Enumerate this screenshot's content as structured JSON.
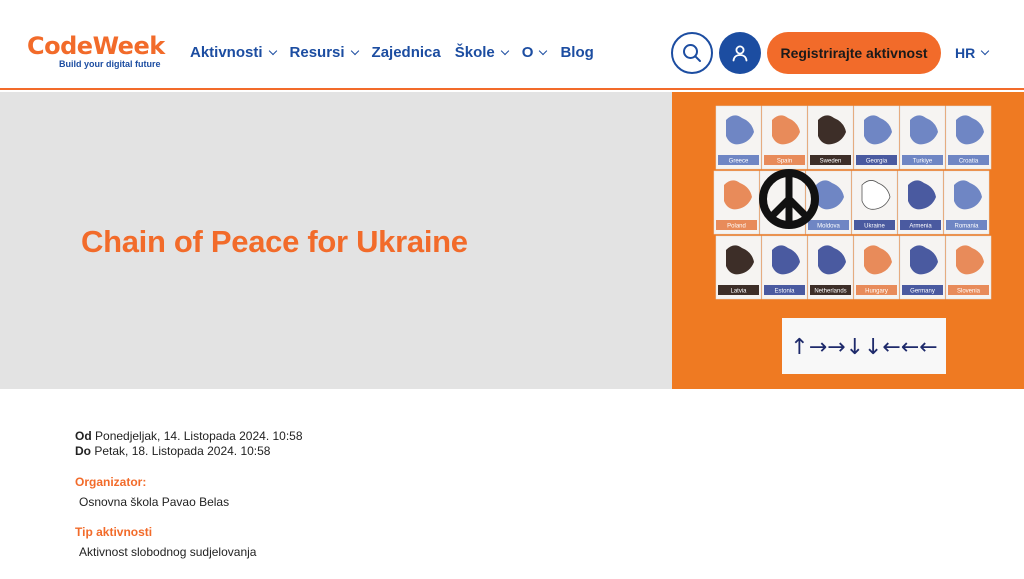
{
  "brand": {
    "code": "Code",
    "week": "Week",
    "tagline": "Build your digital future"
  },
  "nav": {
    "items": [
      {
        "label": "Aktivnosti",
        "dropdown": true
      },
      {
        "label": "Resursi",
        "dropdown": true
      },
      {
        "label": "Zajednica",
        "dropdown": false
      },
      {
        "label": "Škole",
        "dropdown": true
      },
      {
        "label": "O",
        "dropdown": true
      },
      {
        "label": "Blog",
        "dropdown": false
      }
    ]
  },
  "header": {
    "register_label": "Registrirajte aktivnost",
    "language": "HR"
  },
  "hero": {
    "title": "Chain of Peace for Ukraine",
    "image": {
      "cards_row1": [
        "Greece",
        "Spain",
        "Sweden",
        "Georgia",
        "Turkiye",
        "Croatia"
      ],
      "cards_row2": [
        "Poland",
        "",
        "Moldova",
        "Ukraine",
        "Armenia",
        "Romania"
      ],
      "cards_row3": [
        "Latvia",
        "Estonia",
        "Netherlands",
        "Hungary",
        "Germany",
        "Slovenia"
      ],
      "arrows": "↑→→↓↓←←←"
    }
  },
  "details": {
    "from_label": "Od",
    "from_value": "Ponedjeljak, 14. Listopada 2024. 10:58",
    "to_label": "Do",
    "to_value": "Petak, 18. Listopada 2024. 10:58",
    "organizer_label": "Organizator:",
    "organizer_value": "Osnovna škola Pavao Belas",
    "type_label": "Tip aktivnosti",
    "type_value": "Aktivnost slobodnog sudjelovanja"
  },
  "colors": {
    "accent": "#f26b2a",
    "brand_blue": "#1c4da1",
    "hero_bg": "#e3e3e3"
  }
}
